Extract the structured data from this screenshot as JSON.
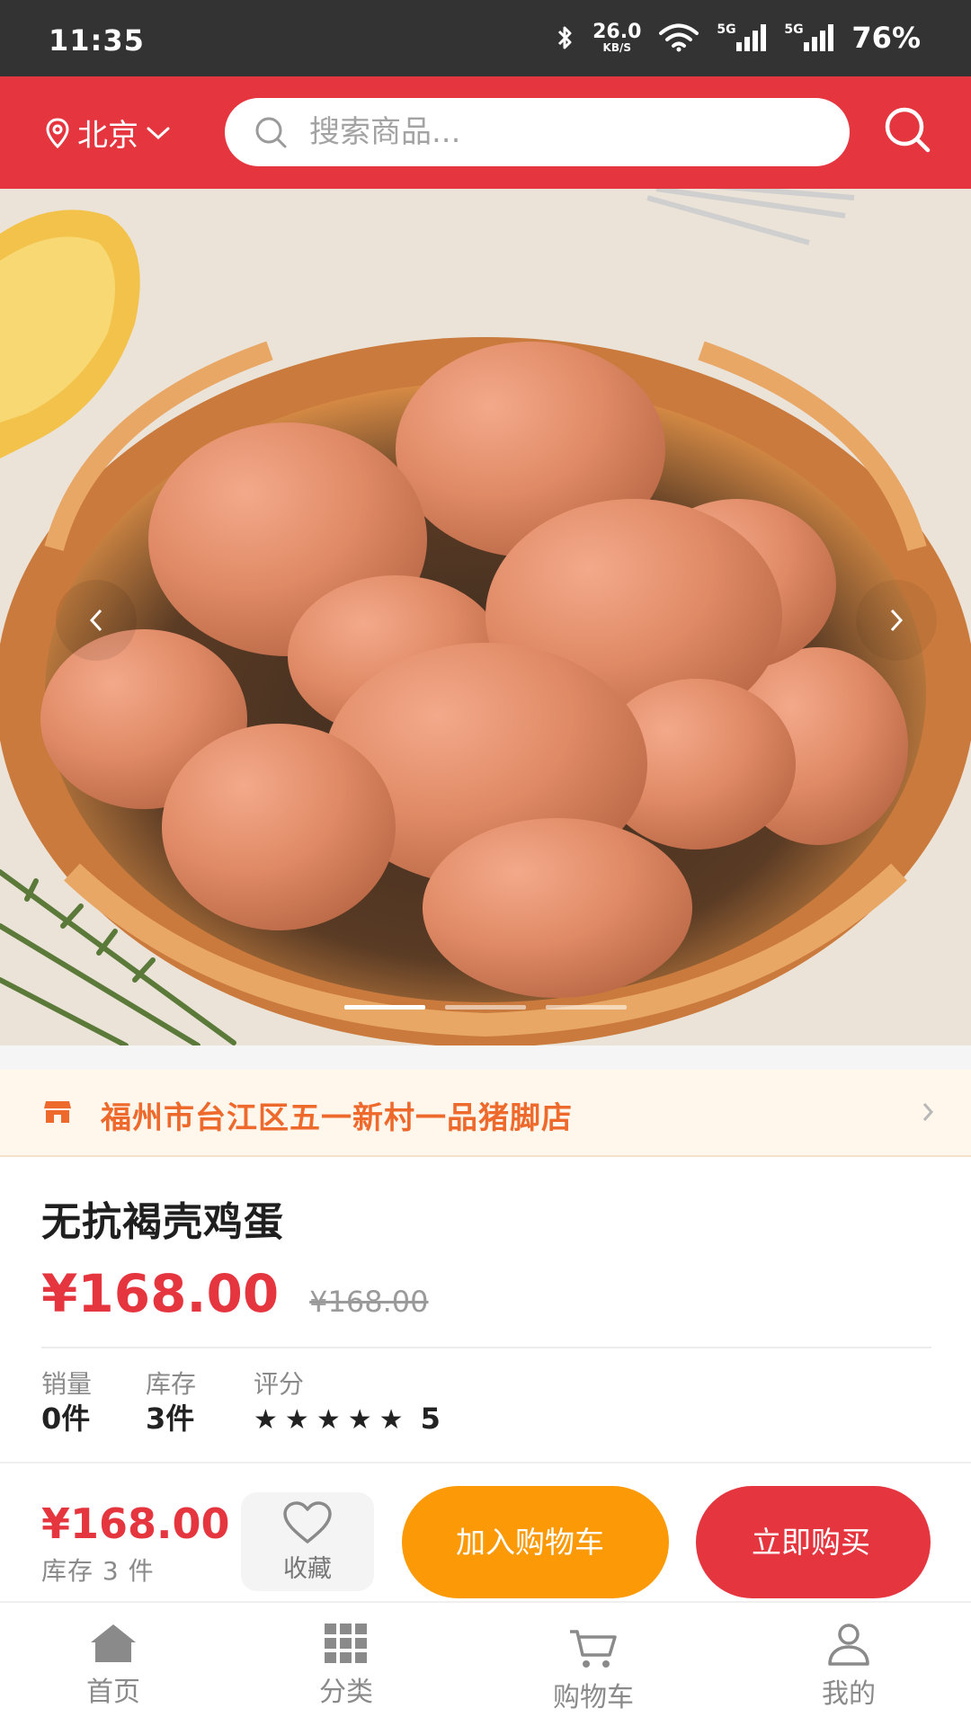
{
  "status_bar": {
    "time": "11:35",
    "net_speed_value": "26.0",
    "net_speed_unit": "KB/S",
    "signal_1": "5G",
    "signal_2": "5G",
    "battery": "76%",
    "icons": [
      "bluetooth-icon",
      "wifi-icon",
      "signal-icon",
      "signal-icon"
    ]
  },
  "header": {
    "location": "北京",
    "search_placeholder": "搜索商品...",
    "accent_color": "#e5363f"
  },
  "banner": {
    "slide_count": 3,
    "active_slide": 1
  },
  "shop": {
    "name": "福州市台江区五一新村一品猪脚店",
    "color": "#ee6a2c"
  },
  "product": {
    "title": "无抗褐壳鸡蛋",
    "price": "¥168.00",
    "original_price": "¥168.00",
    "stats": [
      {
        "label": "销量",
        "value": "0件"
      },
      {
        "label": "库存",
        "value": "3件"
      },
      {
        "label": "评分",
        "stars": "★★★★★",
        "value": "5"
      }
    ]
  },
  "action_bar": {
    "price": "¥168.00",
    "stock": "库存 3 件",
    "favorite_label": "收藏",
    "add_to_cart": "加入购物车",
    "buy_now": "立即购买",
    "cart_color": "#fb9a06",
    "buy_color": "#e5363f"
  },
  "tab_bar": {
    "tabs": [
      {
        "label": "首页",
        "icon": "home-icon"
      },
      {
        "label": "分类",
        "icon": "grid-icon"
      },
      {
        "label": "购物车",
        "icon": "cart-icon"
      },
      {
        "label": "我的",
        "icon": "user-icon"
      }
    ]
  }
}
